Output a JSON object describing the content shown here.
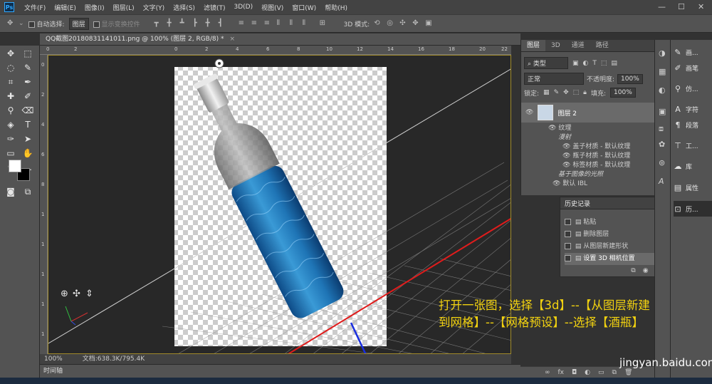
{
  "menubar": {
    "logo": "Ps",
    "items": [
      "文件(F)",
      "编辑(E)",
      "图像(I)",
      "图层(L)",
      "文字(Y)",
      "选择(S)",
      "滤镜(T)",
      "3D(D)",
      "视图(V)",
      "窗口(W)",
      "帮助(H)"
    ],
    "controls": {
      "minimize": "—",
      "maximize": "☐",
      "close": "✕"
    }
  },
  "options": {
    "auto_select_label": "自动选择:",
    "auto_select_value": "图层",
    "show_transform": "显示变换控件",
    "mode_3d_label": "3D 模式:"
  },
  "document": {
    "tab_title": "QQ截图20180831141011.png @ 100% (图层 2, RGB/8) *",
    "tab_close": "×",
    "zoom": "100%",
    "doc_size": "文档:638.3K/795.4K"
  },
  "rulers": {
    "top": [
      "0",
      "2",
      "0",
      "2",
      "4",
      "6",
      "8",
      "10",
      "12",
      "14",
      "16",
      "18",
      "20",
      "22"
    ],
    "left": [
      "0",
      "2",
      "4",
      "6",
      "8",
      "1",
      "1",
      "1",
      "1",
      "1"
    ]
  },
  "timeline": {
    "label": "时间轴"
  },
  "layers_panel": {
    "tabs": [
      "图层",
      "3D",
      "通道",
      "路径"
    ],
    "filter_kind": "类型",
    "blend_mode": "正常",
    "opacity_label": "不透明度:",
    "opacity_value": "100%",
    "lock_label": "锁定:",
    "fill_label": "填充:",
    "fill_value": "100%",
    "layer_name": "图层 2",
    "sub_rows": [
      {
        "text": "纹理",
        "indent": 1,
        "eye": true
      },
      {
        "text": "漫射",
        "indent": 2,
        "eye": false,
        "italic": true
      },
      {
        "text": "盖子材质 - 默认纹理",
        "indent": 3,
        "eye": true
      },
      {
        "text": "瓶子材质 - 默认纹理",
        "indent": 3,
        "eye": true
      },
      {
        "text": "标签材质 - 默认纹理",
        "indent": 3,
        "eye": true
      },
      {
        "text": "基于图像的光照",
        "indent": 2,
        "eye": false,
        "italic": true
      },
      {
        "text": "默认 IBL",
        "indent": 2,
        "eye": true
      }
    ]
  },
  "history_panel": {
    "title": "历史记录",
    "items": [
      "粘贴",
      "删除图层",
      "从图层新建形状",
      "设置 3D 相机位置"
    ]
  },
  "right_panels": {
    "items": [
      "画...",
      "画笔",
      "仿...",
      "字符",
      "段落",
      "工...",
      "库",
      "属性",
      "历..."
    ]
  },
  "caption": {
    "line1": "打开一张图，选择【3d】--【从图层新建",
    "line2": "到网格】--【网格预设】--选择【酒瓶】"
  },
  "watermark": "jingyan.baidu.com"
}
